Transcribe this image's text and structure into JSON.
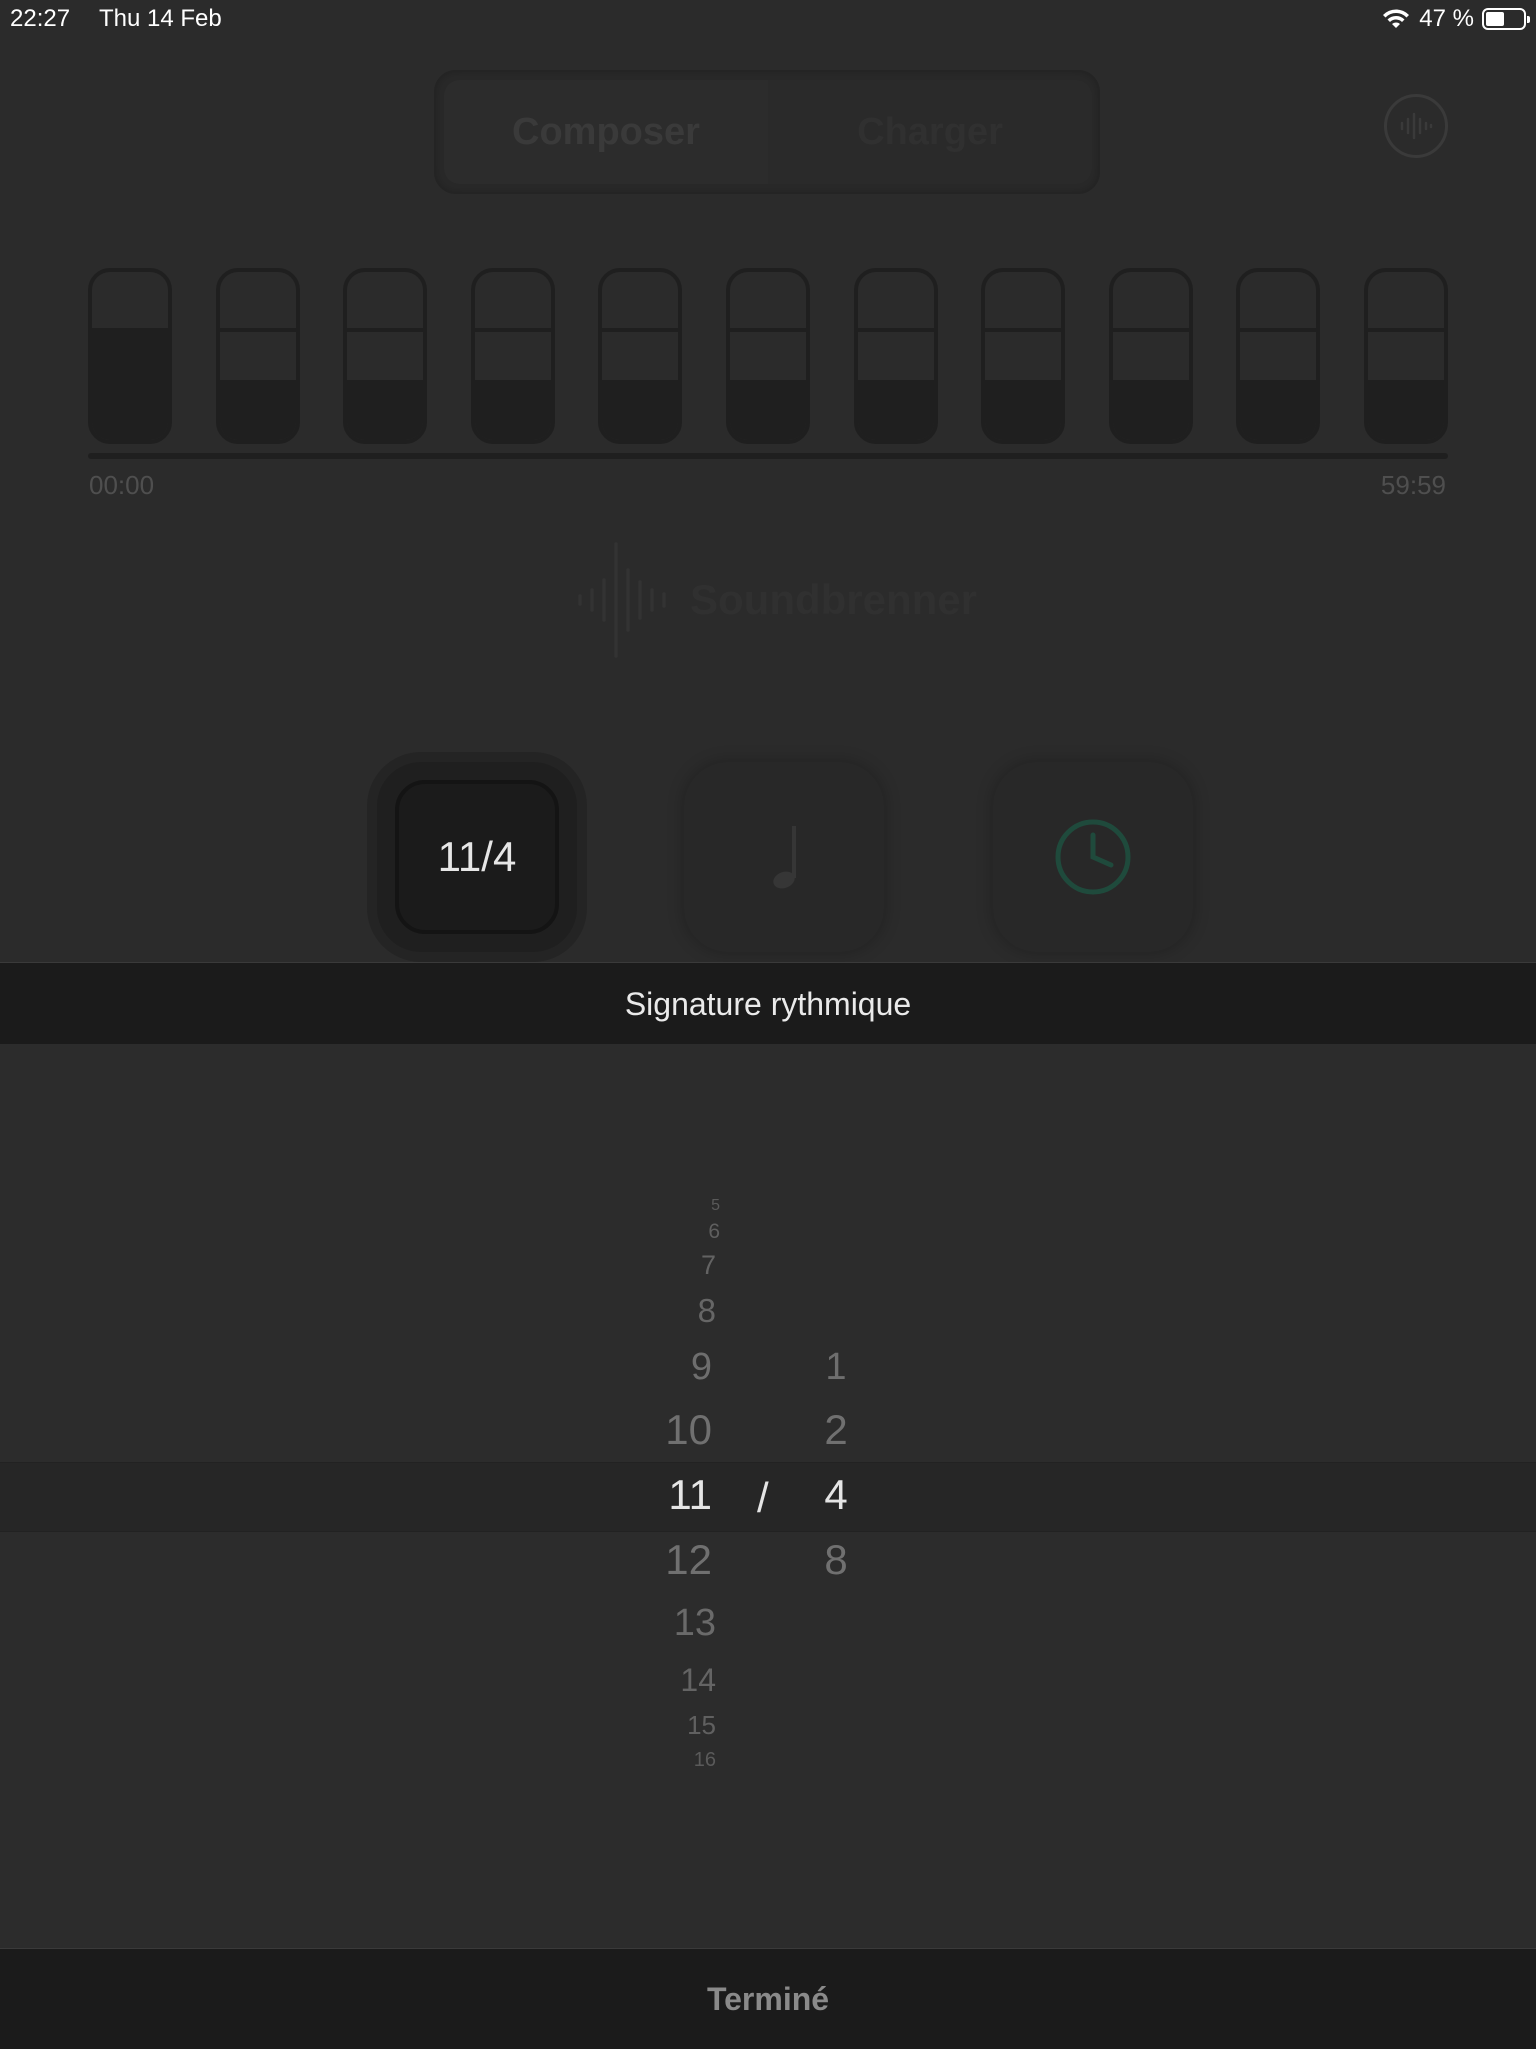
{
  "status": {
    "time": "22:27",
    "date": "Thu 14 Feb",
    "battery": "47 %",
    "battery_level": 0.47
  },
  "tabs": {
    "compose": "Composer",
    "load": "Charger"
  },
  "timeline": {
    "start": "00:00",
    "end": "59:59",
    "bar_count": 11
  },
  "logo": {
    "text": "Soundbrenner"
  },
  "signature_button": {
    "value": "11/4"
  },
  "picker": {
    "title": "Signature rythmique",
    "numerator": [
      "5",
      "6",
      "7",
      "8",
      "9",
      "10",
      "11",
      "12",
      "13",
      "14",
      "15",
      "16"
    ],
    "numerator_selected": "11",
    "separator": "/",
    "denominator": [
      "1",
      "2",
      "4",
      "8"
    ],
    "denominator_selected": "4"
  },
  "footer": {
    "done": "Terminé"
  },
  "colors": {
    "background": "#2b2b2b",
    "panel": "#1b1b1b",
    "clock_accent": "#1f4a3c"
  }
}
